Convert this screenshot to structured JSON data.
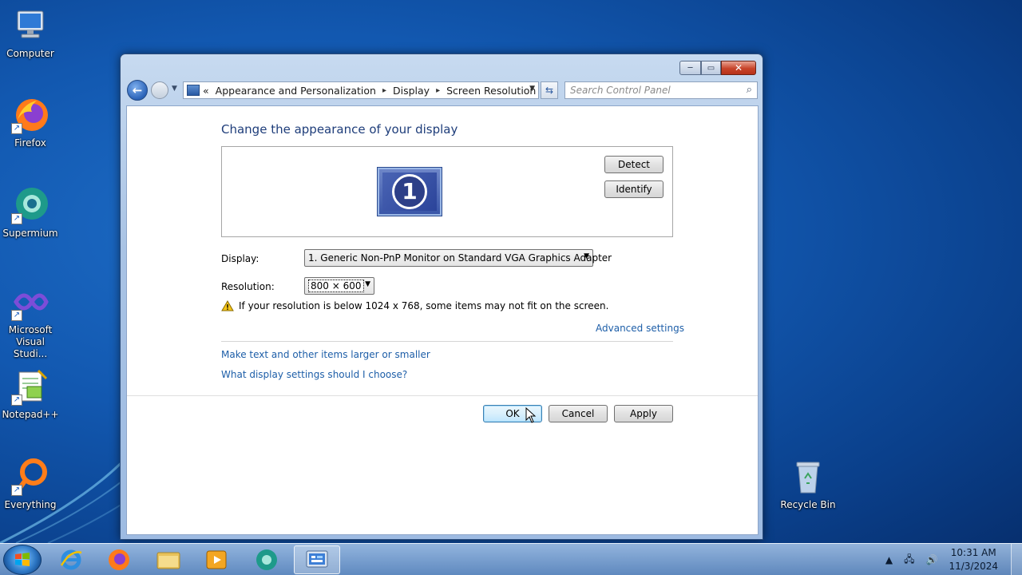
{
  "desktop": {
    "icons": [
      {
        "label": "Computer",
        "icon": "computer-icon"
      },
      {
        "label": "Firefox",
        "icon": "firefox-icon"
      },
      {
        "label": "Supermium",
        "icon": "supermium-icon"
      },
      {
        "label": "Microsoft Visual Studi...",
        "icon": "visual-studio-icon"
      },
      {
        "label": "Notepad++",
        "icon": "notepadpp-icon"
      },
      {
        "label": "Everything",
        "icon": "everything-icon"
      },
      {
        "label": "Recycle Bin",
        "icon": "recycle-bin-icon"
      }
    ]
  },
  "window": {
    "caption": {
      "minimize": "─",
      "maximize": "▭",
      "close": "✕"
    },
    "breadcrumb": {
      "overflow": "«",
      "items": [
        "Appearance and Personalization",
        "Display",
        "Screen Resolution"
      ],
      "separator": "▸"
    },
    "search_placeholder": "Search Control Panel",
    "heading": "Change the appearance of your display",
    "monitor_number": "1",
    "detect_label": "Detect",
    "identify_label": "Identify",
    "display_label": "Display:",
    "display_value": "1. Generic Non-PnP Monitor on Standard VGA Graphics Adapter",
    "resolution_label": "Resolution:",
    "resolution_value": "800 × 600",
    "warning_text": "If your resolution is below 1024 x 768, some items may not fit on the screen.",
    "advanced_link": "Advanced settings",
    "link_text_size": "Make text and other items larger or smaller",
    "link_help": "What display settings should I choose?",
    "ok_label": "OK",
    "cancel_label": "Cancel",
    "apply_label": "Apply"
  },
  "taskbar": {
    "items": [
      "internet-explorer-icon",
      "firefox-icon",
      "file-explorer-icon",
      "media-player-icon",
      "supermium-icon",
      "control-panel-icon"
    ],
    "active_item": "control-panel-icon",
    "clock_time": "10:31 AM",
    "clock_date": "11/3/2024"
  },
  "colors": {
    "desktop_bg": "#1258b0",
    "link": "#1d5ea8",
    "heading": "#1e3d7a"
  }
}
